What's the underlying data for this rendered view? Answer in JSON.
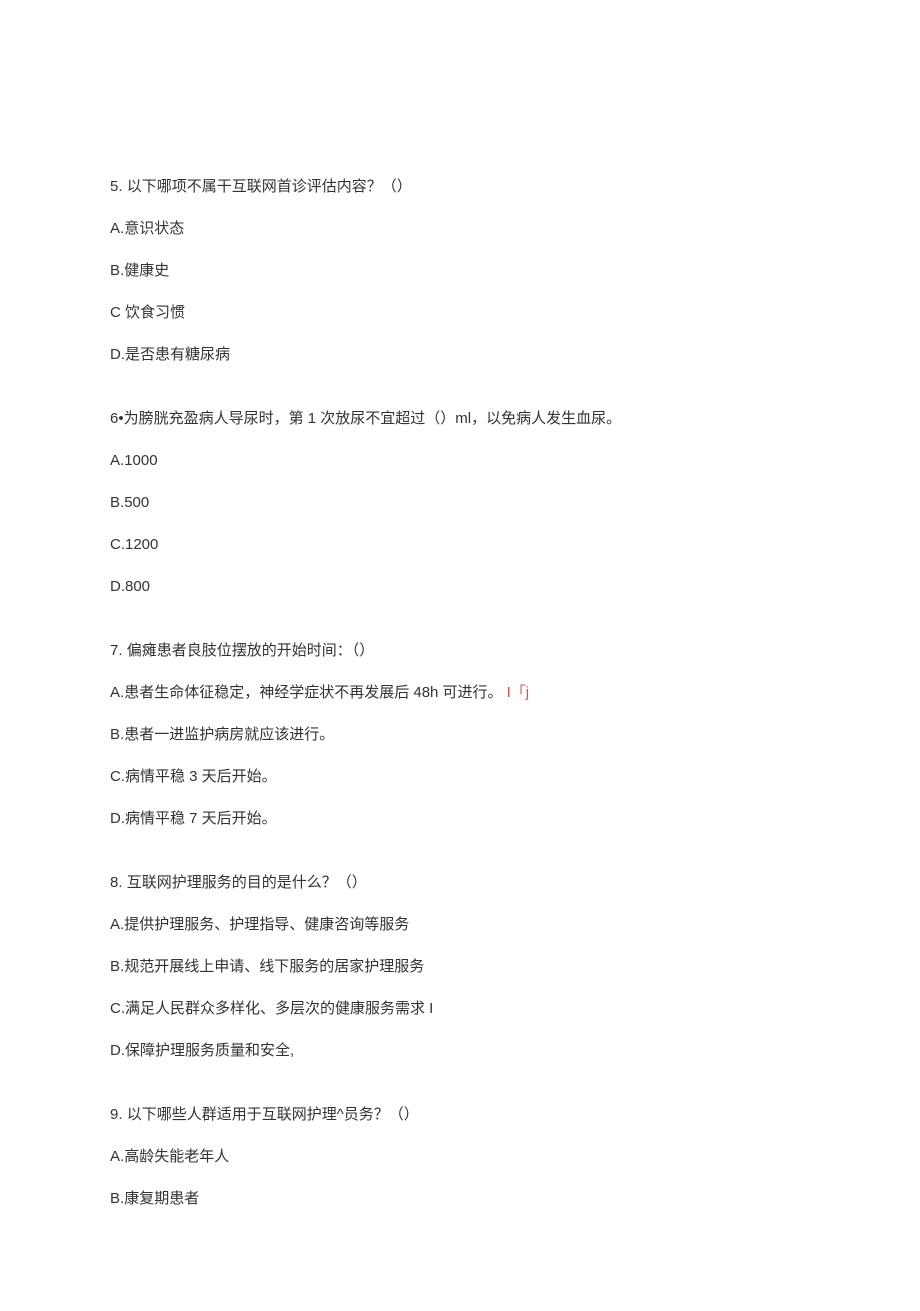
{
  "questions": [
    {
      "number": "5.",
      "text": "以下哪项不属干互联网首诊评估内容？（）",
      "options": [
        {
          "label": "A.",
          "text": "意识状态"
        },
        {
          "label": "B.",
          "text": "健康史"
        },
        {
          "label": "C",
          "text": " 饮食习惯"
        },
        {
          "label": "D.",
          "text": "是否患有糖尿病"
        }
      ]
    },
    {
      "number": "6•",
      "text": "为膀胱充盈病人导尿时，第 1 次放尿不宜超过（）ml，以免病人发生血尿。",
      "options": [
        {
          "label": "A.",
          "text": "1000"
        },
        {
          "label": "B.",
          "text": "500"
        },
        {
          "label": "C.",
          "text": "1200"
        },
        {
          "label": "D.",
          "text": "800"
        }
      ]
    },
    {
      "number": "7.",
      "text": "偏瘫患者良肢位摆放的开始时间：（）",
      "options": [
        {
          "label": "A.",
          "text": "患者生命体征稳定，神经学症状不再发展后 48h 可进行。",
          "mark": "I「j"
        },
        {
          "label": "B.",
          "text": "患者一进监护病房就应该进行。"
        },
        {
          "label": "C.",
          "text": "病情平稳 3 天后开始。"
        },
        {
          "label": "D.",
          "text": "病情平稳 7 天后开始。"
        }
      ]
    },
    {
      "number": "8.",
      "text": "互联网护理服务的目的是什么？（）",
      "options": [
        {
          "label": "A.",
          "text": "提供护理服务、护理指导、健康咨询等服务"
        },
        {
          "label": "B.",
          "text": "规范开展线上申请、线下服务的居家护理服务"
        },
        {
          "label": "C.",
          "text": "满足人民群众多样化、多层次的健康服务需求 I"
        },
        {
          "label": "D.",
          "text": "保障护理服务质量和安全,"
        }
      ]
    },
    {
      "number": "9.",
      "text": "以下哪些人群适用于互联网护理^员务？（）",
      "options": [
        {
          "label": "A.",
          "text": "高龄失能老年人"
        },
        {
          "label": "B.",
          "text": "康复期患者"
        }
      ]
    }
  ]
}
